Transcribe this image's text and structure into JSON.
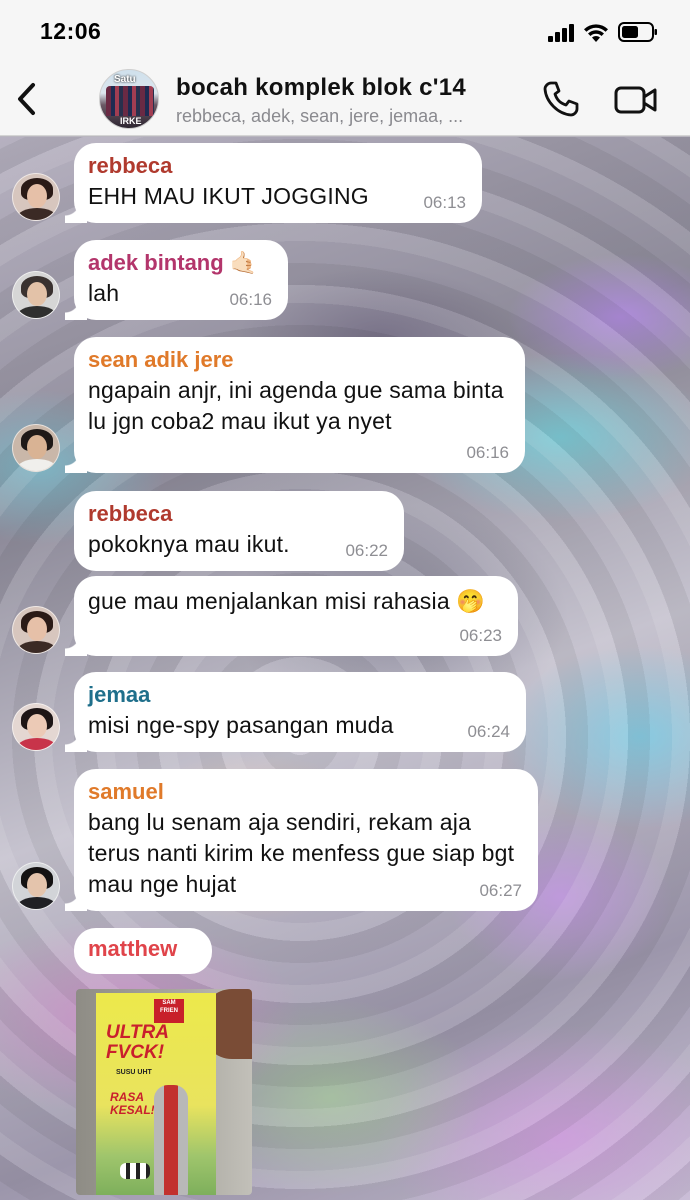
{
  "status_bar": {
    "time": "12:06"
  },
  "header": {
    "title": "bocah komplek blok c'14",
    "members": "rebbeca, adek, sean, jere, jemaa, ...",
    "avatar_text_top": "Satu",
    "avatar_text_bottom": "IRKE"
  },
  "messages": [
    {
      "sender": "rebbeca",
      "sender_color": "#b03a2e",
      "text": "EHH MAU IKUT JOGGING",
      "time": "06:13"
    },
    {
      "sender": "adek bintang 🤙🏻",
      "sender_color": "#b3356b",
      "text": "lah",
      "time": "06:16"
    },
    {
      "sender": "sean adik jere",
      "sender_color": "#e07a2a",
      "text": "ngapain anjr, ini agenda gue sama binta lu jgn coba2 mau ikut ya nyet",
      "time": "06:16"
    },
    {
      "sender": "rebbeca",
      "sender_color": "#b03a2e",
      "text": "pokoknya mau ikut.",
      "time": "06:22"
    },
    {
      "sender": "",
      "sender_color": "#b03a2e",
      "text": "gue mau menjalankan misi rahasia 🤭",
      "time": "06:23"
    },
    {
      "sender": "jemaa",
      "sender_color": "#1f6f8b",
      "text": "misi nge-spy pasangan muda",
      "time": "06:24"
    },
    {
      "sender": "samuel",
      "sender_color": "#e07a2a",
      "text": "bang lu senam aja sendiri, rekam aja terus nanti kirim ke menfess gue siap bgt mau nge hujat",
      "time": "06:27"
    },
    {
      "sender": "matthew",
      "sender_color": "#e0444a",
      "text": "",
      "time": ""
    }
  ],
  "image_message": {
    "brand": "SAM FRIEN",
    "title": "ULTRA FVCK!",
    "subtitle": "SUSU UHT",
    "rasa": "RASA KESAL!"
  },
  "colors": {
    "header_bg": "#f6f6f6",
    "bubble_bg": "#ffffff",
    "time_text": "#8e8e93"
  }
}
